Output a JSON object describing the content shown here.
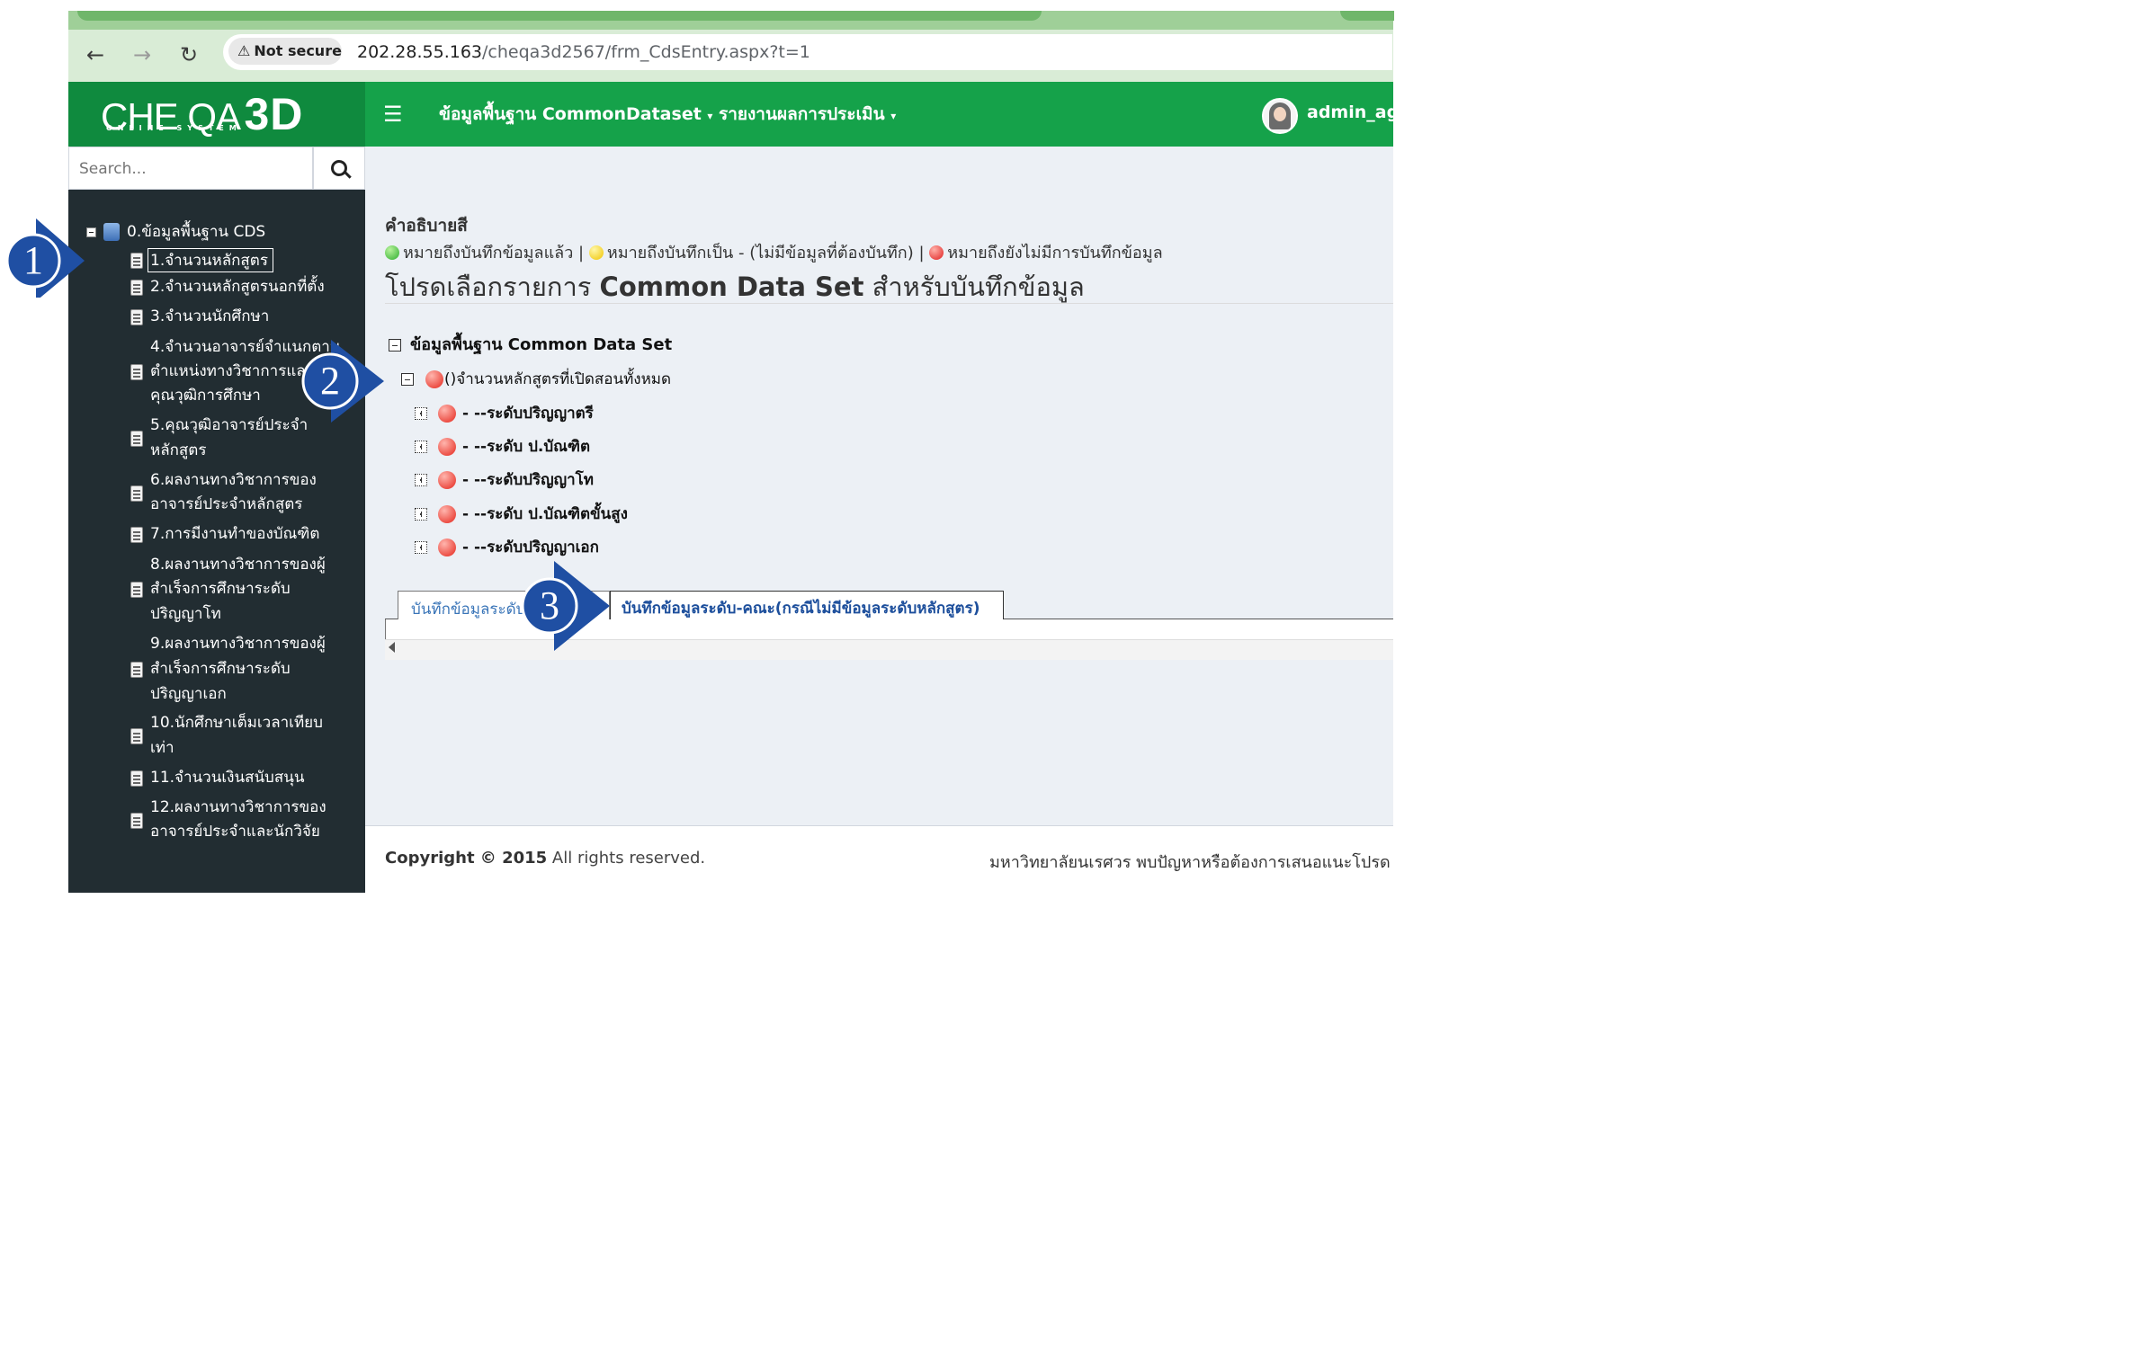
{
  "browser": {
    "security_label": "Not secure",
    "url_host": "202.28.55.163",
    "url_path": "/cheqa3d2567/frm_CdsEntry.aspx?t=1"
  },
  "brand": {
    "name_a": "CHE QA",
    "name_b": "3D",
    "subtitle": "ONLINE SYSTEM"
  },
  "topnav": {
    "menu1": "ข้อมูลพื้นฐาน CommonDataset",
    "menu2": "รายงานผลการประเมิน",
    "user": "admin_agri"
  },
  "sidebar": {
    "search_placeholder": "Search...",
    "root": "0.ข้อมูลพื้นฐาน CDS",
    "items": [
      {
        "lines": [
          "1.จำนวนหลักสูตร"
        ]
      },
      {
        "lines": [
          "2.จำนวนหลักสูตรนอกที่ตั้ง"
        ]
      },
      {
        "lines": [
          "3.จำนวนนักศึกษา"
        ]
      },
      {
        "lines": [
          "4.จำนวนอาจารย์จำแนกตาม",
          "ตำแหน่งทางวิชาการและ",
          "คุณวุฒิการศึกษา"
        ]
      },
      {
        "lines": [
          "5.คุณวุฒิอาจารย์ประจำ",
          "หลักสูตร"
        ]
      },
      {
        "lines": [
          "6.ผลงานทางวิชาการของ",
          "อาจารย์ประจำหลักสูตร"
        ]
      },
      {
        "lines": [
          "7.การมีงานทำของบัณฑิต"
        ]
      },
      {
        "lines": [
          "8.ผลงานทางวิชาการของผู้",
          "สำเร็จการศึกษาระดับ",
          "ปริญญาโท"
        ]
      },
      {
        "lines": [
          "9.ผลงานทางวิชาการของผู้",
          "สำเร็จการศึกษาระดับ",
          "ปริญญาเอก"
        ]
      },
      {
        "lines": [
          "10.นักศึกษาเต็มเวลาเทียบ",
          "เท่า"
        ]
      },
      {
        "lines": [
          "11.จำนวนเงินสนับสนุน"
        ]
      },
      {
        "lines": [
          "12.ผลงานทางวิชาการของ",
          "อาจารย์ประจำและนักวิจัย"
        ]
      }
    ]
  },
  "legend": {
    "title": "คำอธิบายสี",
    "green": "หมายถึงบันทึกข้อมูลแล้ว |",
    "yellow": "หมายถึงบันทึกเป็น - (ไม่มีข้อมูลที่ต้องบันทึก) |",
    "red": "หมายถึงยังไม่มีการบันทึกข้อมูล",
    "colors": {
      "green": "#2fae2f",
      "yellow": "#f0c400",
      "red": "#e02020"
    }
  },
  "main": {
    "heading_pre": "โปรดเลือกรายการ ",
    "heading_bold": "Common Data Set",
    "heading_post": " สำหรับบันทึกข้อมูล",
    "tree_root": "ข้อมูลพื้นฐาน Common Data Set",
    "tree_node": "()จำนวนหลักสูตรที่เปิดสอนทั้งหมด",
    "tree_children": [
      "- --ระดับปริญญาตรี",
      "- --ระดับ ป.บัณฑิต",
      "- --ระดับปริญญาโท",
      "- --ระดับ ป.บัณฑิตขั้นสูง",
      "- --ระดับปริญญาเอก"
    ],
    "tabs": [
      "บันทึกข้อมูลระดับหลักสูตร",
      "บันทึกข้อมูลระดับ-คณะ(กรณีไม่มีข้อมูลระดับหลักสูตร)"
    ]
  },
  "footer": {
    "copyright_bold": "Copyright © 2015",
    "copyright_rest": " All rights reserved.",
    "right_text": "มหาวิทยาลัยนเรศวร พบปัญหาหรือต้องการเสนอแนะโปรด"
  },
  "callouts": [
    "1",
    "2",
    "3"
  ],
  "colors": {
    "header_green": "#15a24a",
    "brand_green": "#0f8a3e",
    "sidebar_bg": "#222d32",
    "callout_blue": "#1f4fa3"
  }
}
